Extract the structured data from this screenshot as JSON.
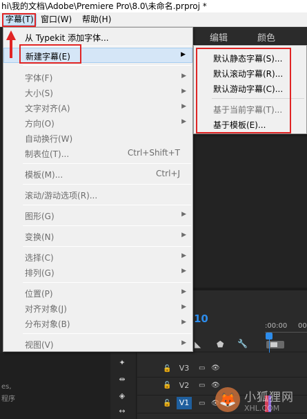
{
  "window": {
    "title": "hi\\我的文档\\Adobe\\Premiere Pro\\8.0\\未命名.prproj *"
  },
  "menubar": {
    "items": [
      {
        "label": "字幕(T)"
      },
      {
        "label": "窗口(W)"
      },
      {
        "label": "帮助(H)"
      }
    ]
  },
  "panel_tabs": [
    "编辑",
    "颜色"
  ],
  "title_menu": {
    "items": [
      {
        "label": "从 Typekit 添加字体...",
        "enabled": true
      },
      {
        "label": "新建字幕(E)",
        "enabled": true,
        "submenu": true
      },
      {
        "label": "字体(F)",
        "enabled": false,
        "submenu": true
      },
      {
        "label": "大小(S)",
        "enabled": false,
        "submenu": true
      },
      {
        "label": "文字对齐(A)",
        "enabled": false,
        "submenu": true
      },
      {
        "label": "方向(O)",
        "enabled": false,
        "submenu": true
      },
      {
        "label": "自动换行(W)",
        "enabled": false
      },
      {
        "label": "制表位(T)...",
        "enabled": false,
        "shortcut": "Ctrl+Shift+T"
      },
      {
        "label": "模板(M)...",
        "enabled": false,
        "shortcut": "Ctrl+J"
      },
      {
        "label": "滚动/游动选项(R)...",
        "enabled": false
      },
      {
        "label": "图形(G)",
        "enabled": false,
        "submenu": true
      },
      {
        "label": "变换(N)",
        "enabled": false,
        "submenu": true
      },
      {
        "label": "选择(C)",
        "enabled": false,
        "submenu": true
      },
      {
        "label": "排列(G)",
        "enabled": false,
        "submenu": true
      },
      {
        "label": "位置(P)",
        "enabled": false,
        "submenu": true
      },
      {
        "label": "对齐对象(J)",
        "enabled": false,
        "submenu": true
      },
      {
        "label": "分布对象(B)",
        "enabled": false,
        "submenu": true
      },
      {
        "label": "视图(V)",
        "enabled": false,
        "submenu": true
      }
    ],
    "submenu_arrow": "▶"
  },
  "new_title_submenu": {
    "items": [
      {
        "label": "默认静态字幕(S)...",
        "enabled": true
      },
      {
        "label": "默认滚动字幕(R)...",
        "enabled": true
      },
      {
        "label": "默认游动字幕(C)...",
        "enabled": true
      },
      {
        "label": "基于当前字幕(T)...",
        "enabled": false
      },
      {
        "label": "基于模板(E)...",
        "enabled": true
      }
    ]
  },
  "timeline": {
    "timecode_fragment": "10",
    "ruler_times": [
      ":00:00",
      "00"
    ],
    "tracks": [
      {
        "name": "V3",
        "selected": false
      },
      {
        "name": "V2",
        "selected": false
      },
      {
        "name": "V1",
        "selected": true
      }
    ]
  },
  "left_panel_text": [
    "es,",
    "程序"
  ],
  "watermark": {
    "title": "小狐狸网",
    "subtitle": "XHL.COM"
  },
  "colors": {
    "annotation_red": "#e02424",
    "timecode_blue": "#2d8ceb",
    "selected_track": "#1f5f9e"
  }
}
